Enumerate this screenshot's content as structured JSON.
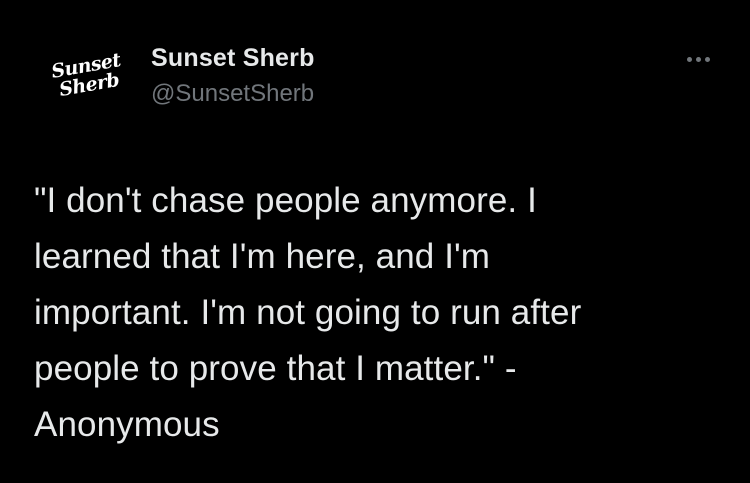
{
  "author": {
    "avatar_logo_lines": [
      "Sunset",
      "Sherb"
    ],
    "display_name": "Sunset Sherb",
    "handle": "@SunsetSherb"
  },
  "more_menu": {
    "icon": "more-horizontal-icon"
  },
  "tweet": {
    "text": "\"I don't chase people anymore. I\nlearned that I'm here, and I'm\nimportant. I'm not going to run after\npeople to prove that I matter.\" -\nAnonymous"
  },
  "colors": {
    "background": "#000000",
    "primary_text": "#e7e9ea",
    "secondary_text": "#71767b"
  }
}
